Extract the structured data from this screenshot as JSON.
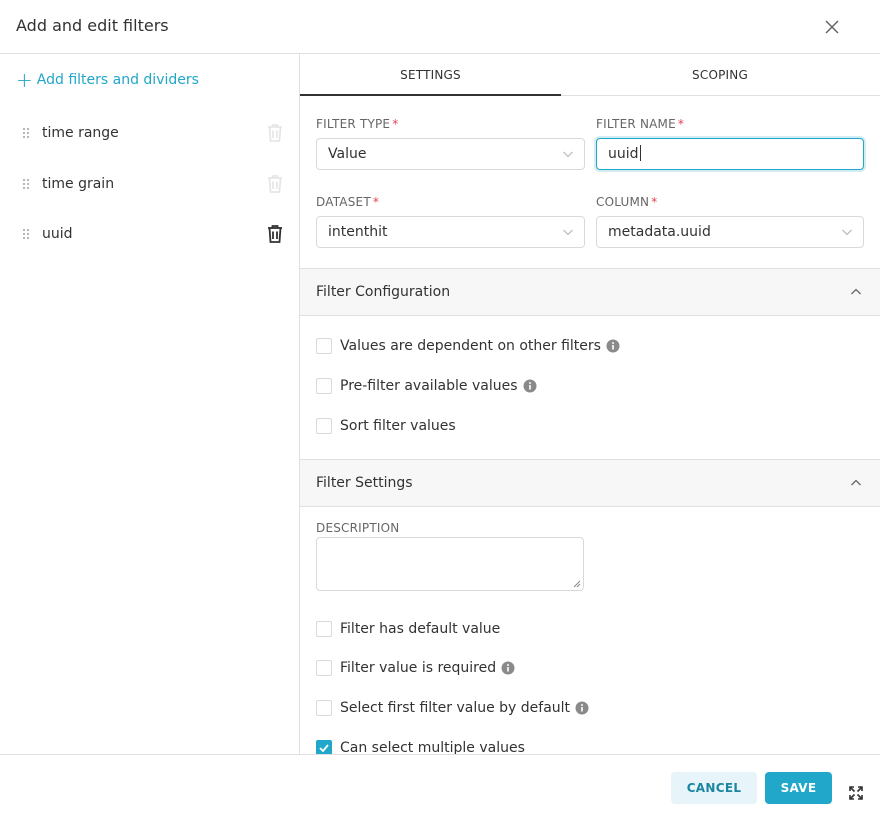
{
  "header": {
    "title": "Add and edit filters",
    "close_icon": "close-icon"
  },
  "sidebar": {
    "add_label": "Add filters and dividers",
    "items": [
      {
        "label": "time range",
        "active": false
      },
      {
        "label": "time grain",
        "active": false
      },
      {
        "label": "uuid",
        "active": true
      }
    ]
  },
  "tabs": [
    {
      "label": "SETTINGS",
      "active": true
    },
    {
      "label": "SCOPING",
      "active": false
    }
  ],
  "form": {
    "filter_type": {
      "label": "FILTER TYPE",
      "value": "Value"
    },
    "filter_name": {
      "label": "FILTER NAME",
      "value": "uuid"
    },
    "dataset": {
      "label": "DATASET",
      "value": "intenthit"
    },
    "column": {
      "label": "COLUMN",
      "value": "metadata.uuid"
    },
    "required_mark": "*"
  },
  "filter_configuration": {
    "title": "Filter Configuration",
    "options": [
      {
        "label": "Values are dependent on other filters",
        "checked": false,
        "info": true
      },
      {
        "label": "Pre-filter available values",
        "checked": false,
        "info": true
      },
      {
        "label": "Sort filter values",
        "checked": false,
        "info": false
      }
    ]
  },
  "filter_settings": {
    "title": "Filter Settings",
    "description_label": "DESCRIPTION",
    "description_value": "",
    "options": [
      {
        "label": "Filter has default value",
        "checked": false,
        "info": false
      },
      {
        "label": "Filter value is required",
        "checked": false,
        "info": true
      },
      {
        "label": "Select first filter value by default",
        "checked": false,
        "info": true
      },
      {
        "label": "Can select multiple values",
        "checked": true,
        "info": false
      }
    ]
  },
  "footer": {
    "cancel_label": "CANCEL",
    "save_label": "SAVE"
  },
  "colors": {
    "accent": "#20a7c9",
    "required": "#e04355",
    "active_item_bg": "#ebedf1"
  }
}
